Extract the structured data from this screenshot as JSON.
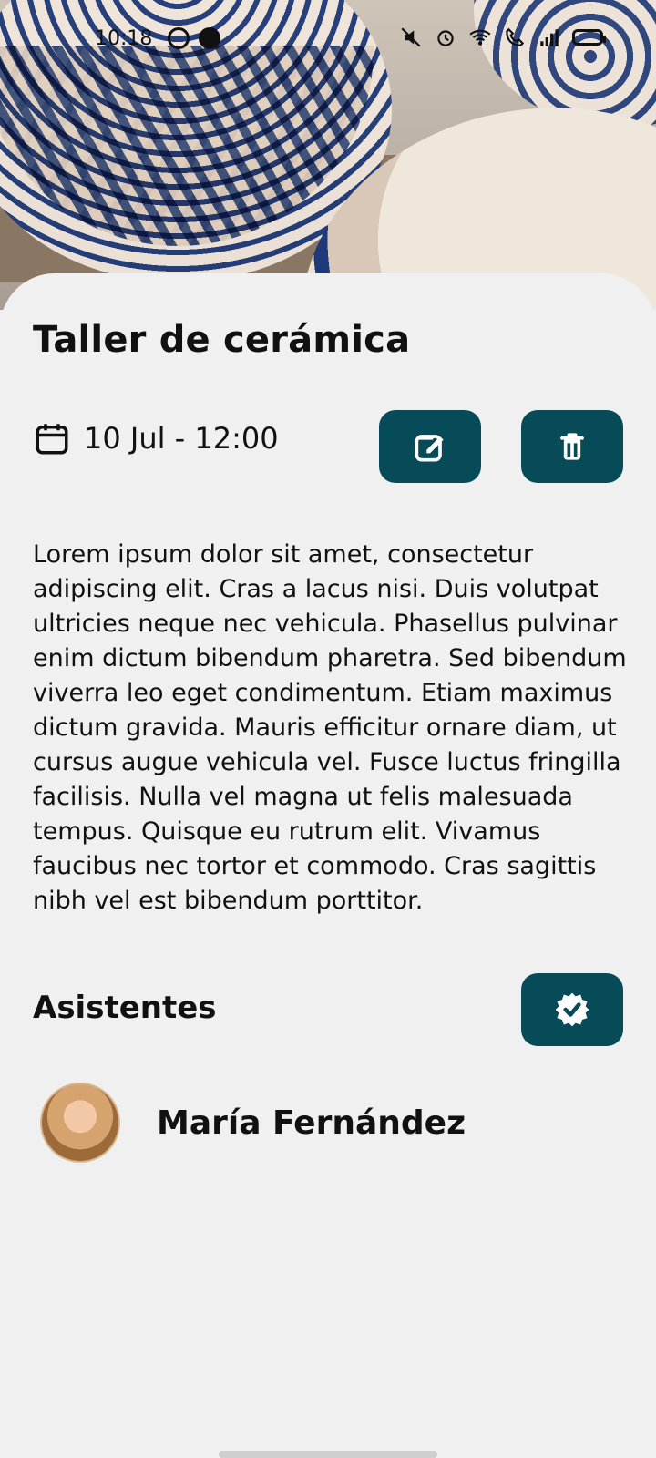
{
  "status_bar": {
    "time": "10:18"
  },
  "event": {
    "title": "Taller de cerámica",
    "date_time": "10 Jul - 12:00",
    "description": "Lorem ipsum dolor sit amet, consectetur adipiscing elit. Cras a lacus nisi. Duis volutpat ultricies neque nec vehicula. Phasellus pulvinar enim dictum bibendum pharetra. Sed bibendum viverra leo eget condimentum. Etiam maximus dictum gravida. Mauris efficitur ornare diam, ut cursus augue vehicula vel. Fusce luctus fringilla facilisis. Nulla vel magna ut felis malesuada tempus. Quisque eu rutrum elit. Vivamus faucibus nec tortor et commodo. Cras sagittis nibh vel est bibendum porttitor."
  },
  "attendees": {
    "section_title": "Asistentes",
    "items": [
      {
        "name": "María Fernández"
      }
    ]
  },
  "icons": {
    "status_left": [
      "whatsapp-icon",
      "notification-icon"
    ],
    "status_right": [
      "mute-icon",
      "alarm-icon",
      "wifi-icon",
      "call-icon",
      "signal-icon",
      "battery-icon"
    ],
    "date": "calendar-icon",
    "edit": "edit-icon",
    "delete": "trash-icon",
    "confirm": "verified-check-icon"
  },
  "colors": {
    "primary": "#064b57",
    "background": "#f0f0f0",
    "text": "#111111"
  }
}
